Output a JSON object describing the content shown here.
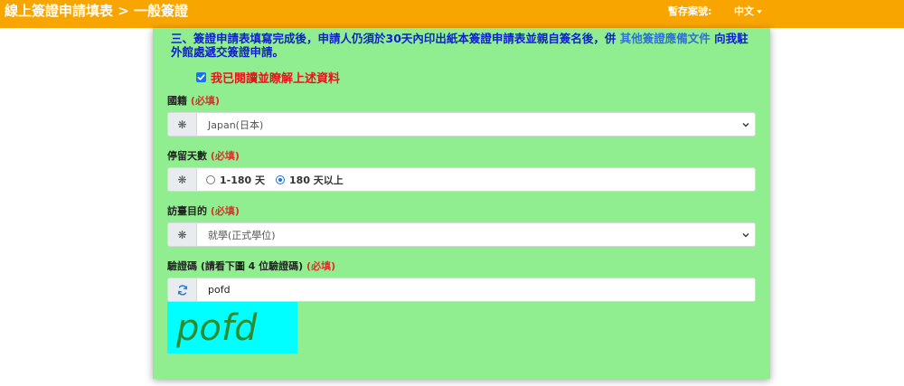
{
  "header": {
    "title": "線上簽證申請填表 > 一般簽證",
    "saved_label": "暫存案號:",
    "language": "中文"
  },
  "notice": {
    "text_before": "三、簽證申請表填寫完成後，申請人仍須於30天內印出紙本簽證申請表並親自簽名後，併",
    "link_text": "其他簽證應備文件",
    "text_after": "向我駐外館處遞交簽證申請。"
  },
  "acknowledge": {
    "label": "我已閱讀並瞭解上述資料",
    "checked": true
  },
  "fields": {
    "nationality": {
      "label": "國籍",
      "required": "(必填)",
      "value": "Japan(日本)"
    },
    "stay_days": {
      "label": "停留天數",
      "required": "(必填)",
      "options": [
        "1-180 天",
        "180 天以上"
      ],
      "selected": "180 天以上"
    },
    "purpose": {
      "label": "訪臺目的",
      "required": "(必填)",
      "value": "就學(正式學位)"
    },
    "captcha": {
      "label": "驗證碼 (請看下圖 4 位驗證碼)",
      "required": "(必填)",
      "value": "pofd",
      "image_text": "pofd"
    }
  },
  "colors": {
    "topbar": "#f8a500",
    "panel": "#90ee90",
    "notice_text": "#1020d0",
    "ack_text": "#e8141c",
    "required_text": "#d9342b",
    "captcha_bg": "#00ffff",
    "captcha_text": "#2e8b2e"
  },
  "icons": {
    "field_addon": "asterisk-icon",
    "captcha_refresh": "refresh-icon",
    "dropdown": "chevron-down-icon"
  }
}
